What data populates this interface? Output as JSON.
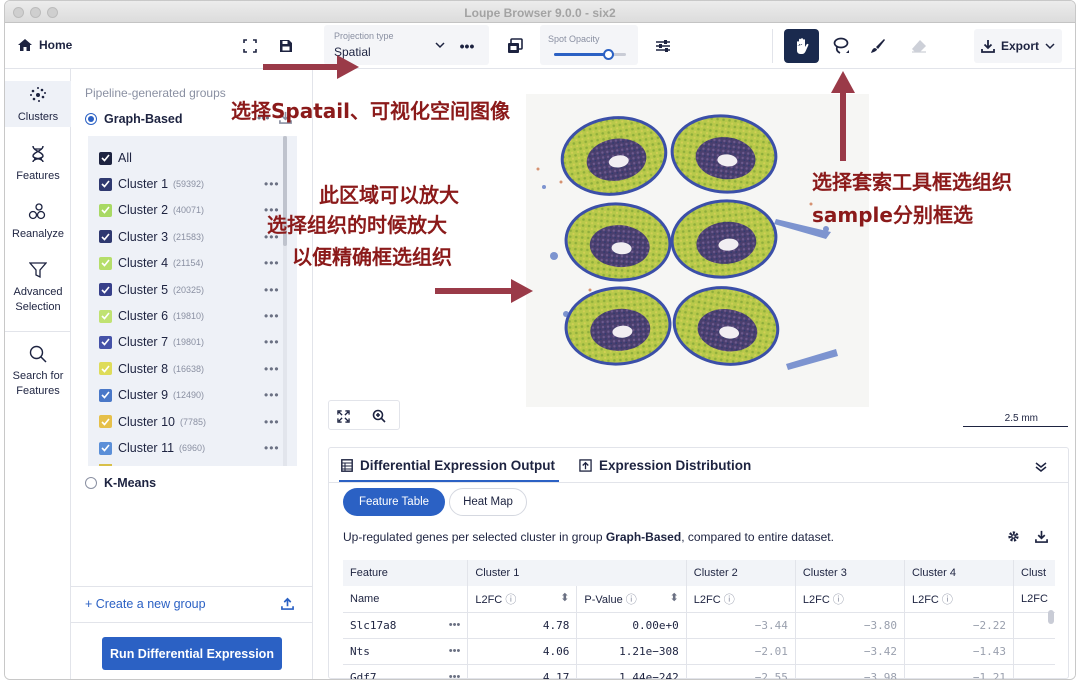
{
  "window": {
    "title": "Loupe Browser 9.0.0 - six2"
  },
  "toolbar": {
    "home_label": "Home",
    "projection_label": "Projection type",
    "projection_value": "Spatial",
    "spot_opacity_label": "Spot Opacity",
    "spot_opacity_value": 0.75,
    "export_label": "Export"
  },
  "rail": {
    "items": [
      "Clusters",
      "Features",
      "Reanalyze",
      "Advanced Selection",
      "Search for Features"
    ]
  },
  "groups": {
    "section_title": "Pipeline-generated groups",
    "graph_based": "Graph-Based",
    "all_label": "All",
    "k_means": "K-Means",
    "clusters": [
      {
        "name": "Cluster 1",
        "count": "(59392)",
        "color": "#2f3970"
      },
      {
        "name": "Cluster 2",
        "count": "(40071)",
        "color": "#a8d964"
      },
      {
        "name": "Cluster 3",
        "count": "(21583)",
        "color": "#2f3970"
      },
      {
        "name": "Cluster 4",
        "count": "(21154)",
        "color": "#b5de6a"
      },
      {
        "name": "Cluster 5",
        "count": "(20325)",
        "color": "#37408a"
      },
      {
        "name": "Cluster 6",
        "count": "(19810)",
        "color": "#c0e272"
      },
      {
        "name": "Cluster 7",
        "count": "(19801)",
        "color": "#4552a8"
      },
      {
        "name": "Cluster 8",
        "count": "(16638)",
        "color": "#dedc5a"
      },
      {
        "name": "Cluster 9",
        "count": "(12490)",
        "color": "#4a78c8"
      },
      {
        "name": "Cluster 10",
        "count": "(7785)",
        "color": "#e6c04a"
      },
      {
        "name": "Cluster 11",
        "count": "(6960)",
        "color": "#5b8fd8"
      }
    ],
    "create_group": "+ Create a new group",
    "run_button": "Run Differential Expression"
  },
  "viewer": {
    "scale_label": "2.5 mm"
  },
  "de_panel": {
    "tab_output": "Differential Expression Output",
    "tab_distribution": "Expression Distribution",
    "sub_feature_table": "Feature Table",
    "sub_heat_map": "Heat Map",
    "description_prefix": "Up-regulated genes per selected cluster in group ",
    "description_group": "Graph-Based",
    "description_suffix": ", compared to entire dataset.",
    "col_feature": "Feature",
    "col_clusters": [
      "Cluster 1",
      "Cluster 2",
      "Cluster 3",
      "Cluster 4",
      "Clust"
    ],
    "col_name": "Name",
    "col_l2fc": "L2FC",
    "col_pvalue": "P-Value",
    "col_l2fc_cut": "L2FC",
    "rows": [
      {
        "name": "Slc17a8",
        "c1_l2fc": "4.78",
        "c1_p": "0.00e+0",
        "c2": "−3.44",
        "c3": "−3.80",
        "c4": "−2.22"
      },
      {
        "name": "Nts",
        "c1_l2fc": "4.06",
        "c1_p": "1.21e−308",
        "c2": "−2.01",
        "c3": "−3.42",
        "c4": "−1.43"
      },
      {
        "name": "Gdf7",
        "c1_l2fc": "4.17",
        "c1_p": "1.44e−242",
        "c2": "−2.55",
        "c3": "−3.98",
        "c4": "−1.21"
      }
    ]
  },
  "annotations": {
    "a1": "选择Spatail、可视化空间图像",
    "a2_l1": "此区域可以放大",
    "a2_l2": "选择组织的时候放大",
    "a2_l3": "以便精确框选组织",
    "a3_l1": "选择套索工具框选组织",
    "a3_l2": "sample分别框选",
    "arrow_color": "#9a3a48"
  }
}
